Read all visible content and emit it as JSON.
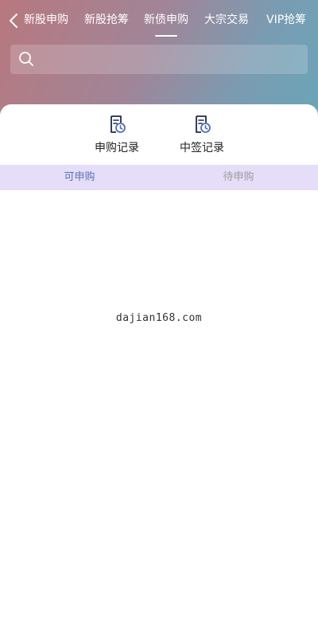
{
  "colors": {
    "header_gradient_start": "#b8787e",
    "header_gradient_end": "#6aa5b8",
    "subtab_bg": "#e6def8",
    "subtab_active": "#5b6fc2",
    "subtab_inactive": "#9a9a9a",
    "icon_dark": "#1e2a4a",
    "icon_accent": "#4d6bbf"
  },
  "header": {
    "back_icon": "chevron-left-icon",
    "tabs": [
      {
        "label": "新股申购"
      },
      {
        "label": "新股抢筹"
      },
      {
        "label": "新债申购"
      },
      {
        "label": "大宗交易"
      },
      {
        "label": "VIP抢筹"
      }
    ],
    "active_tab": "新债申购"
  },
  "search": {
    "icon": "search-icon",
    "placeholder": "",
    "value": ""
  },
  "records": {
    "subscription_records": {
      "label": "申购记录",
      "icon": "document-clock-icon"
    },
    "winning_records": {
      "label": "中签记录",
      "icon": "document-clock-icon"
    }
  },
  "subtabs": {
    "available": {
      "label": "可申购"
    },
    "pending": {
      "label": "待申购"
    },
    "active": "可申购"
  },
  "watermark": {
    "text": "dajian168.com"
  }
}
